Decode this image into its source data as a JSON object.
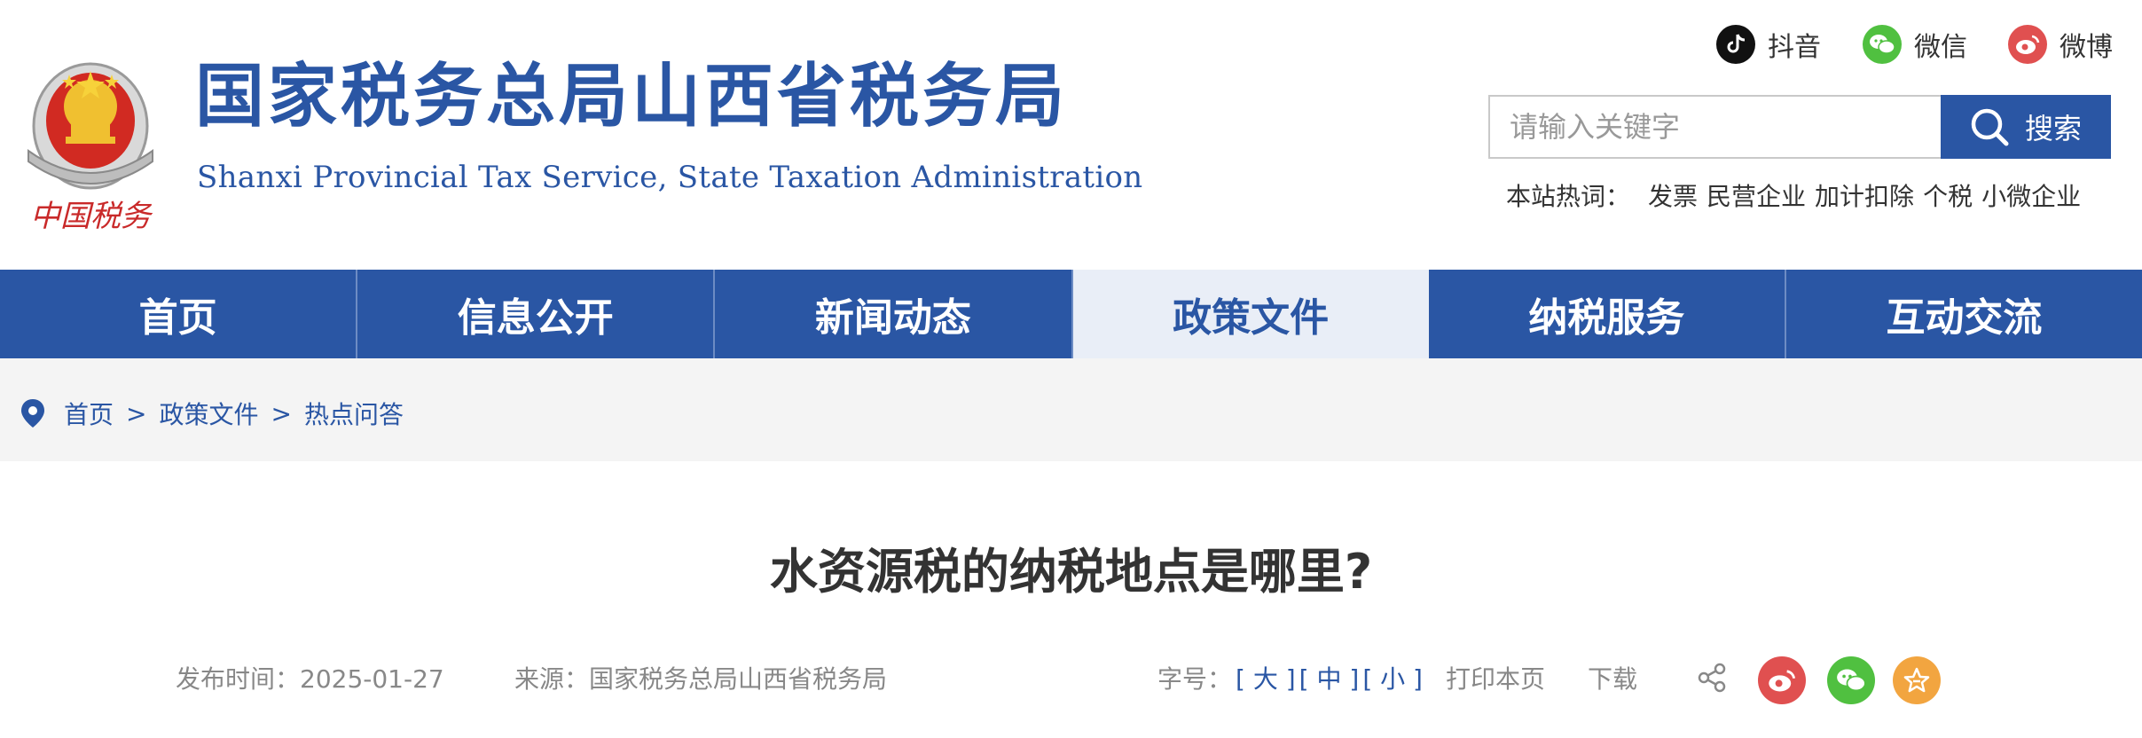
{
  "header": {
    "emblem_text": "中国税务",
    "title": "国家税务总局山西省税务局",
    "subtitle": "Shanxi Provincial Tax Service, State Taxation Administration",
    "social": [
      {
        "label": "抖音",
        "icon": "douyin-icon"
      },
      {
        "label": "微信",
        "icon": "wechat-icon"
      },
      {
        "label": "微博",
        "icon": "weibo-icon"
      }
    ],
    "search": {
      "placeholder": "请输入关键字",
      "button_label": "搜索"
    },
    "hot": {
      "label": "本站热词：",
      "items": [
        "发票",
        "民营企业",
        "加计扣除",
        "个税",
        "小微企业"
      ]
    }
  },
  "nav": {
    "items": [
      {
        "label": "首页",
        "active": false
      },
      {
        "label": "信息公开",
        "active": false
      },
      {
        "label": "新闻动态",
        "active": false
      },
      {
        "label": "政策文件",
        "active": true
      },
      {
        "label": "纳税服务",
        "active": false
      },
      {
        "label": "互动交流",
        "active": false
      }
    ]
  },
  "breadcrumb": {
    "items": [
      "首页",
      "政策文件",
      "热点问答"
    ],
    "separator": ">"
  },
  "article": {
    "title": "水资源税的纳税地点是哪里?",
    "date_label": "发布时间：2025-01-27",
    "source_label": "来源：国家税务总局山西省税务局",
    "font_size_label": "字号：",
    "font_sizes": [
      "[ 大 ]",
      "[ 中 ]",
      "[ 小 ]"
    ],
    "print_label": "打印本页",
    "download_label": "下载"
  },
  "colors": {
    "brand_blue": "#2a56a4",
    "nav_active_bg": "#e9eef7",
    "weibo_red": "#e05050",
    "wechat_green": "#50c040",
    "fav_orange": "#f2a540"
  }
}
